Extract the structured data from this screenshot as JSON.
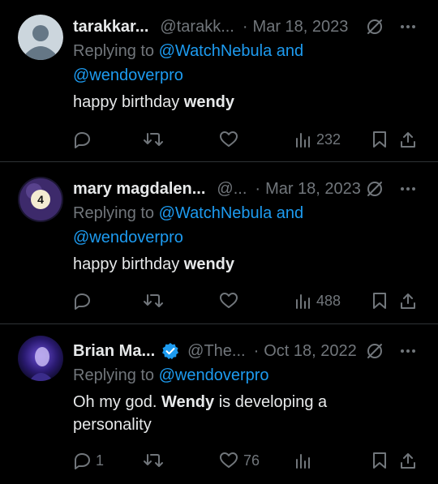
{
  "tweets": [
    {
      "name": "tarakkar...",
      "handle": "@tarakk...",
      "date": "Mar 18, 2023",
      "verified": false,
      "replying_prefix": "Replying to",
      "mentions_text": "@WatchNebula and",
      "mentions_text2": "@wendoverpro",
      "text_before": "happy birthday ",
      "text_bold": "wendy",
      "text_after": "",
      "reply_count": "",
      "retweet_count": "",
      "like_count": "",
      "view_count": "232",
      "avatar": "default-avatar-icon"
    },
    {
      "name": "mary magdalen...",
      "handle": "@...",
      "date": "Mar 18, 2023",
      "verified": false,
      "replying_prefix": "Replying to",
      "mentions_text": "@WatchNebula and",
      "mentions_text2": "@wendoverpro",
      "text_before": "happy birthday ",
      "text_bold": "wendy",
      "text_after": "",
      "reply_count": "",
      "retweet_count": "",
      "like_count": "",
      "view_count": "488",
      "avatar": "billiard-ball-4-icon",
      "avatar_number": "4"
    },
    {
      "name": "Brian Ma...",
      "handle": "@The...",
      "date": "Oct 18, 2022",
      "verified": true,
      "replying_prefix": "Replying to",
      "mentions_text": "@wendoverpro",
      "text_before": "Oh my god. ",
      "text_bold": "Wendy",
      "text_after": " is developing a",
      "text_line2": "personality",
      "reply_count": "1",
      "retweet_count": "",
      "like_count": "76",
      "view_count": "",
      "avatar": "profile-photo"
    }
  ],
  "colors": {
    "background": "#000000",
    "text": "#e7e9ea",
    "muted": "#71767b",
    "link": "#1d9bf0",
    "divider": "#2f3336",
    "verified": "#1d9bf0"
  }
}
